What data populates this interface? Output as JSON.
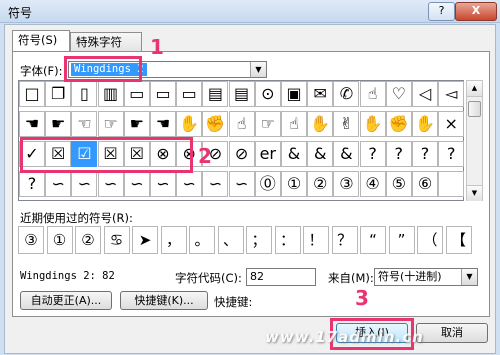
{
  "window": {
    "title": "符号",
    "help_btn": "?",
    "close_btn": "X"
  },
  "tabs": [
    {
      "label": "符号(S)"
    },
    {
      "label": "特殊字符(P)"
    }
  ],
  "font": {
    "label": "字体(F):",
    "value": "Wingdings 2"
  },
  "symbol_rows": [
    [
      "□",
      "❐",
      "▯",
      "▥",
      "▭",
      "▭",
      "▭",
      "▤",
      "▤",
      "⊙",
      "▣",
      "✉",
      "✆",
      "☝",
      "♡",
      "◁",
      "◅"
    ],
    [
      "☚",
      "☛",
      "☜",
      "☞",
      "☛",
      "☚",
      "✋",
      "✊",
      "☝",
      "☞",
      "☝",
      "✋",
      "✌",
      "✋",
      "✊",
      "✋",
      "×"
    ],
    [
      "✓",
      "☒",
      "☑",
      "☒",
      "☒",
      "⊗",
      "⊗",
      "⊘",
      "⊘",
      "er",
      "&",
      "&",
      "&",
      "?",
      "?",
      "?",
      "?"
    ],
    [
      "?",
      "∽",
      "∽",
      "∽",
      "∽",
      "∽",
      "∽",
      "∽",
      "∽",
      "⓪",
      "①",
      "②",
      "③",
      "④",
      "⑤",
      "⑥",
      ""
    ]
  ],
  "recent": {
    "label": "近期使用过的符号(R):",
    "symbols": [
      "③",
      "①",
      "②",
      "♋",
      "➤",
      "，",
      "。",
      "、",
      "；",
      "：",
      "！",
      "？",
      "“",
      "”",
      "（",
      "【"
    ]
  },
  "status": {
    "char_name": "Wingdings 2: 82",
    "code_label": "字符代码(C):",
    "code_value": "82",
    "from_label": "来自(M):",
    "from_value": "符号(十进制)"
  },
  "buttons": {
    "autocorrect": "自动更正(A)...",
    "shortcut_key": "快捷键(K)...",
    "shortcut_label": "快捷键:",
    "insert": "插入(I)",
    "cancel": "取消"
  },
  "annotations": {
    "step1": "1",
    "step2": "2",
    "step3": "3"
  },
  "watermark": "www.17admin.cn",
  "colors": {
    "annotation": "#e8356f",
    "selection": "#3399ff"
  }
}
